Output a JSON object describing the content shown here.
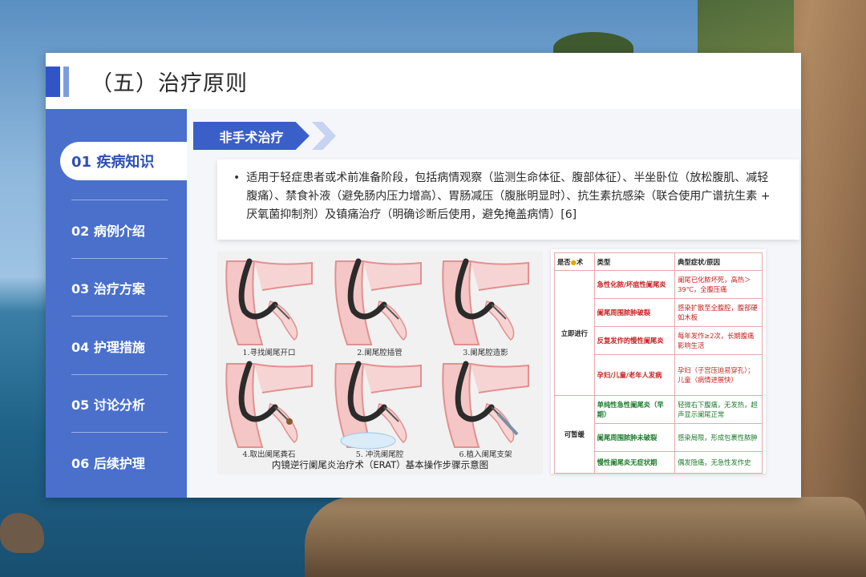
{
  "slide": {
    "title": "（五）治疗原则",
    "section_tag": "非手术治疗",
    "bullet": "适用于轻症患者或术前准备阶段，包括病情观察（监测生命体征、腹部体征）、半坐卧位（放松腹肌、减轻腹痛）、禁食补液（避免肠内压力增高）、胃肠减压（腹胀明显时）、抗生素抗感染（联合使用广谱抗生素 + 厌氧菌抑制剂）及镇痛治疗（明确诊断后使用，避免掩盖病情）[6]"
  },
  "sidebar": {
    "items": [
      {
        "label": "01 疾病知识",
        "active": true
      },
      {
        "label": "02 病例介绍",
        "active": false
      },
      {
        "label": "03 治疗方案",
        "active": false
      },
      {
        "label": "04 护理措施",
        "active": false
      },
      {
        "label": "05 讨论分析",
        "active": false
      },
      {
        "label": "06 后续护理",
        "active": false
      }
    ]
  },
  "figure": {
    "steps": [
      "1.寻找阑尾开口",
      "2.阑尾腔插管",
      "3.阑尾腔造影",
      "4.取出阑尾粪石",
      "5. 冲洗阑尾腔",
      "6.植入阑尾支架"
    ],
    "caption": "内镜逆行阑尾炎治疗术（ERAT）基本操作步骤示意图"
  },
  "table": {
    "headers": {
      "timing_prefix": "是否",
      "timing_suffix": "术",
      "type": "类型",
      "symptoms": "典型症状/原因"
    },
    "groups": [
      {
        "timing": "立即进行",
        "rows": [
          {
            "type": "急性化脓/坏疽性阑尾炎",
            "symptoms": "阑尾已化脓坏死，高热＞39℃，全腹压痛"
          },
          {
            "type": "阑尾周围脓肿破裂",
            "symptoms": "感染扩散至全腹腔，腹部硬如木板"
          },
          {
            "type": "反复发作的慢性阑尾炎",
            "symptoms": "每年发作≥2次，长期腹痛影响生活"
          },
          {
            "type": "孕妇/儿童/老年人发病",
            "symptoms": "孕妇（子宫压迫易穿孔）；儿童（病情进展快）"
          }
        ]
      },
      {
        "timing": "可暂缓",
        "rows": [
          {
            "type": "单纯性急性阑尾炎（早期）",
            "symptoms": "轻微右下腹痛，无发热，超声显示阑尾正常"
          },
          {
            "type": "阑尾周围脓肿未破裂",
            "symptoms": "感染局限，形成包裹性脓肿"
          },
          {
            "type": "慢性阑尾炎无症状期",
            "symptoms": "偶发隐痛，无急性发作史"
          }
        ]
      }
    ]
  },
  "colors": {
    "brand_blue": "#4a70cc",
    "tag_blue": "#3b5fc8",
    "urgent_red": "#c81f1f",
    "defer_green": "#1c7a2c"
  }
}
